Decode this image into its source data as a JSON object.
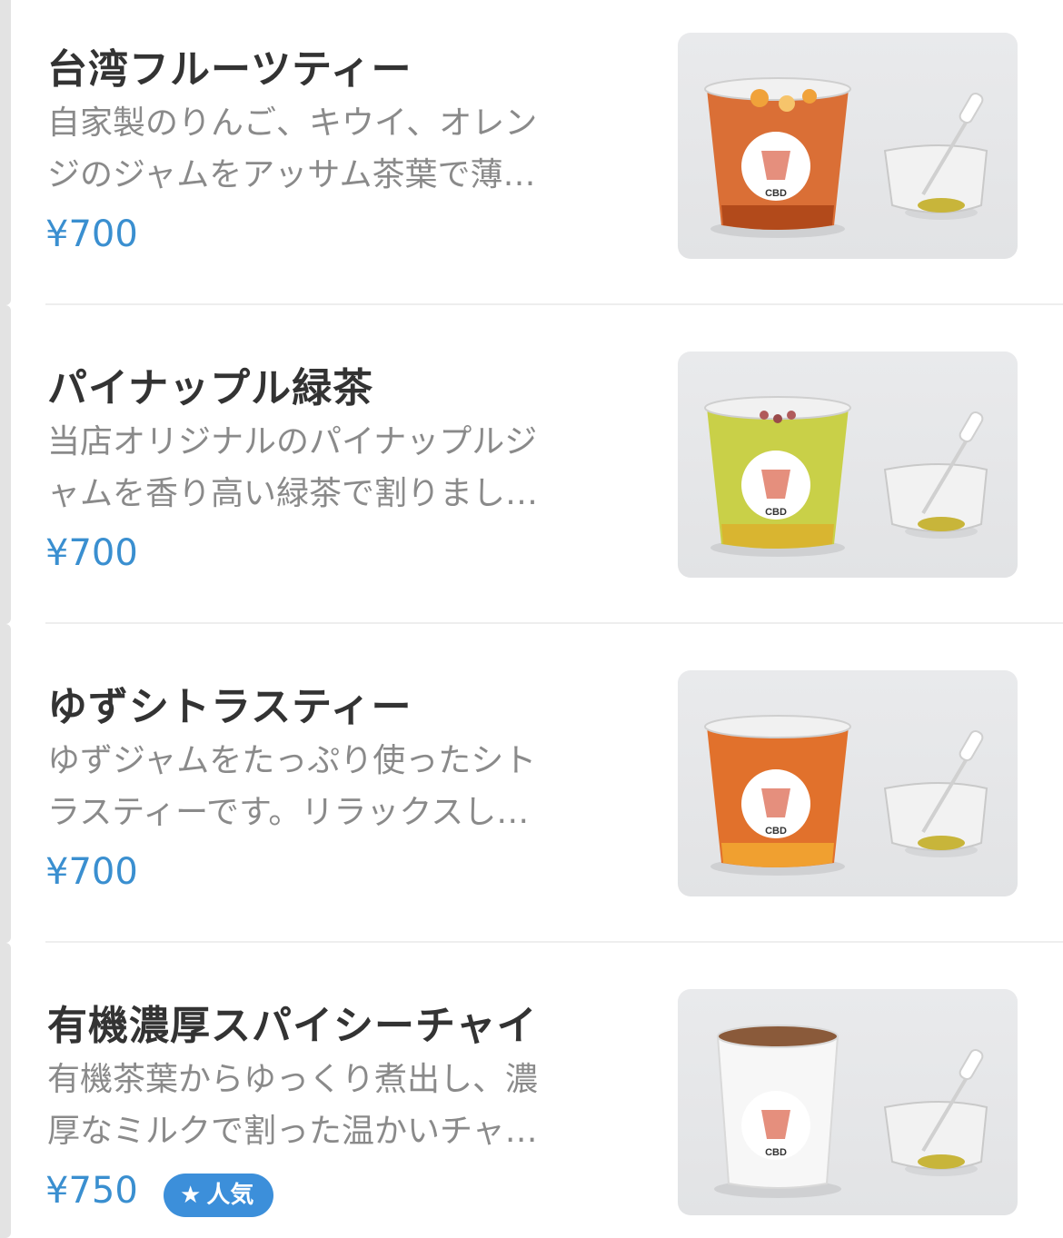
{
  "items": [
    {
      "title": "台湾フルーツティー",
      "desc_line1": "自家製のりんご、キウイ、オレン",
      "desc_line2": "ジのジャムをアッサム茶葉で薄…",
      "price": "¥700",
      "logo_text": "CBD",
      "drink_color": "#d9682c"
    },
    {
      "title": "パイナップル緑茶",
      "desc_line1": "当店オリジナルのパイナップルジ",
      "desc_line2": "ャムを香り高い緑茶で割りまし…",
      "price": "¥700",
      "logo_text": "CBD",
      "drink_color": "#c7cf3f"
    },
    {
      "title": "ゆずシトラスティー",
      "desc_line1": "ゆずジャムをたっぷり使ったシト",
      "desc_line2": "ラスティーです。リラックスし…",
      "price": "¥700",
      "logo_text": "CBD",
      "drink_color": "#e06a22"
    },
    {
      "title": "有機濃厚スパイシーチャイ",
      "desc_line1": "有機茶葉からゆっくり煮出し、濃",
      "desc_line2": "厚なミルクで割った温かいチャ…",
      "price": "¥750",
      "logo_text": "CBD",
      "drink_color": "#f4f4f4",
      "badge": "人気"
    }
  ],
  "colors": {
    "accent": "#3a8fd0",
    "badge_bg": "#3c8fda",
    "title": "#333333",
    "desc": "#8a8a8a"
  }
}
